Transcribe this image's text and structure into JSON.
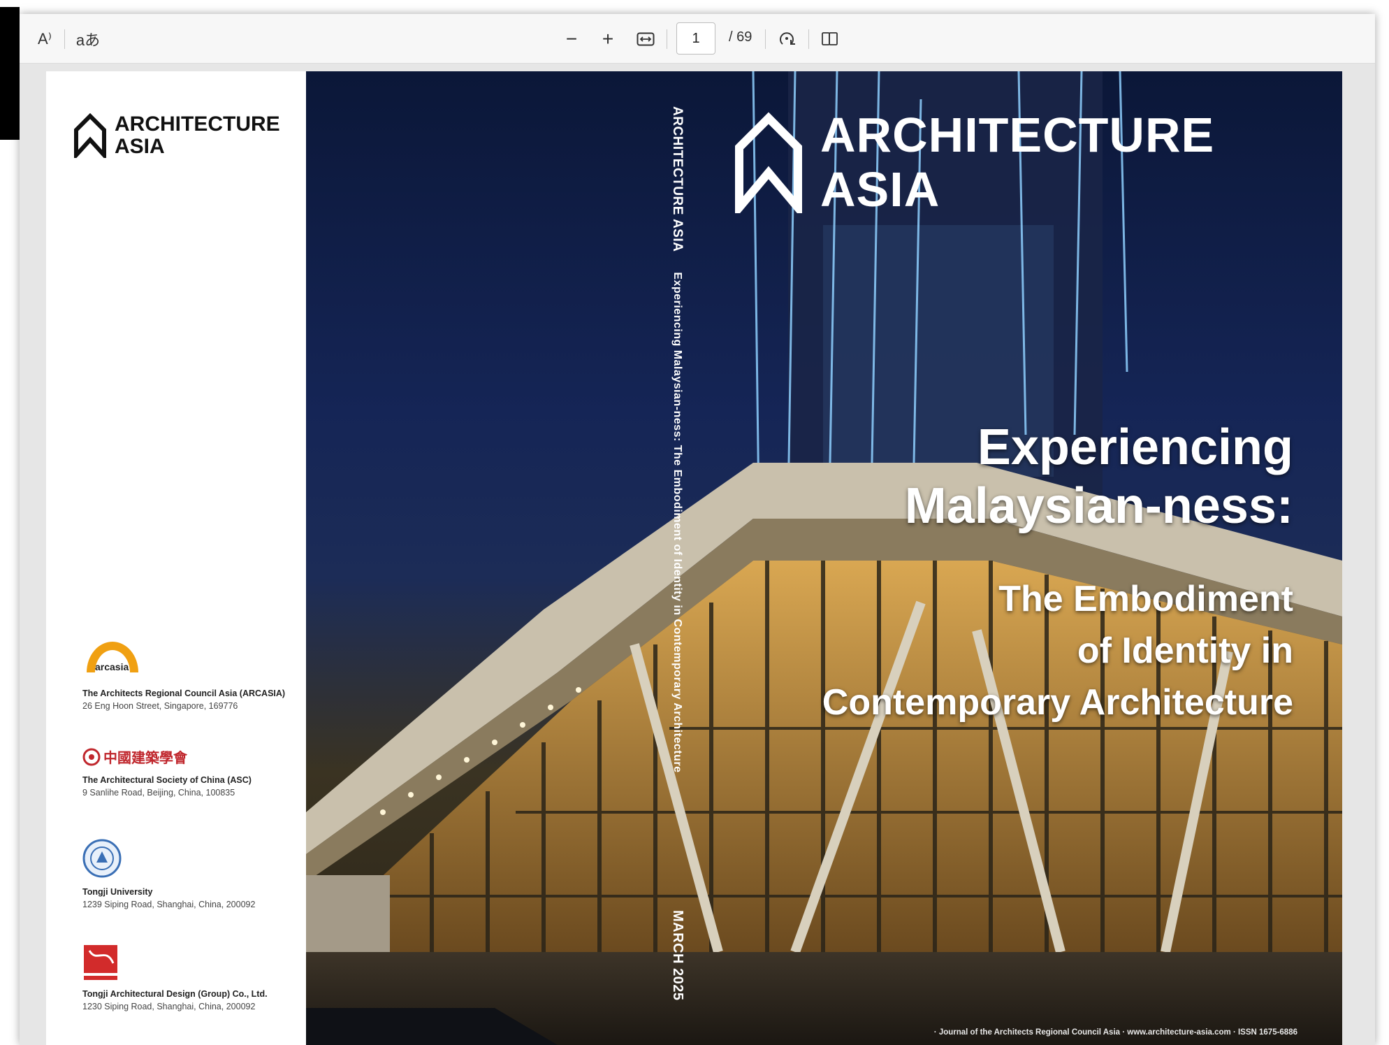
{
  "toolbar": {
    "read_aloud_icon": "A⁾",
    "translate_icon": "aあ",
    "zoom_out": "−",
    "zoom_in": "+",
    "page_current": "1",
    "page_total": "/ 69"
  },
  "left_page": {
    "logo_line1": "ARCHITECTURE",
    "logo_line2": "ASIA",
    "orgs": [
      {
        "logo_text": "arcasia",
        "name": "The Architects Regional Council Asia (ARCASIA)",
        "address": "26 Eng Hoon Street, Singapore, 169776"
      },
      {
        "logo_text": "中國建築學會",
        "name": "The Architectural Society of China (ASC)",
        "address": "9 Sanlihe Road, Beijing, China, 100835"
      },
      {
        "logo_text": "",
        "name": "Tongji University",
        "address": "1239 Siping Road, Shanghai, China, 200092"
      },
      {
        "logo_text": "",
        "name": "Tongji Architectural Design (Group) Co., Ltd.",
        "address": "1230 Siping Road, Shanghai, China, 200092"
      }
    ]
  },
  "cover": {
    "spine_title": "ARCHITECTURE  ASIA",
    "spine_subtitle": "Experiencing Malaysian-ness: The Embodiment of Identity in Contemporary Architecture",
    "spine_date": "MARCH 2025",
    "logo_line1": "ARCHITECTURE",
    "logo_line2": "ASIA",
    "headline_1": "Experiencing",
    "headline_2": "Malaysian-ness:",
    "sub_1": "The Embodiment",
    "sub_2": "of Identity in",
    "sub_3": "Contemporary Architecture",
    "footer": "· Journal of the Architects Regional Council Asia  ·  www.architecture-asia.com  ·  ISSN 1675-6886"
  }
}
